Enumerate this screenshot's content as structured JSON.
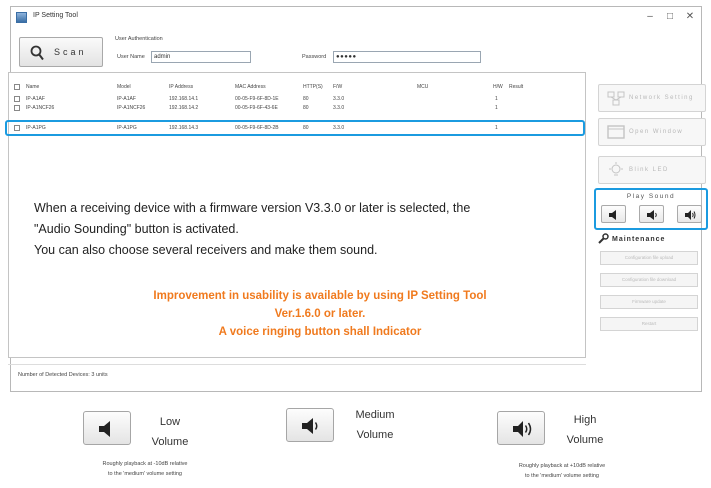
{
  "window": {
    "title": "IP Setting Tool",
    "minimize": "–",
    "maximize": "□",
    "close": "✕"
  },
  "toolbar": {
    "scan_label": "Scan"
  },
  "auth": {
    "title": "User Authentication",
    "username_label": "User Name",
    "username_value": "admin",
    "password_label": "Password",
    "password_value": "●●●●●"
  },
  "table": {
    "headers": [
      "Name",
      "Model",
      "IP Address",
      "MAC Address",
      "HTTP(S)",
      "F/W",
      "MCU",
      "H/W",
      "Result"
    ],
    "rows": [
      [
        "IP-A1AF",
        "IP-A1AF",
        "192.168.14.1",
        "00-05-F9-6F-8D-1E",
        "80",
        "3.3.0",
        "",
        "1",
        ""
      ],
      [
        "IP-A1NCF26",
        "IP-A1NCF26",
        "192.168.14.2",
        "00-05-F9-6F-43-6E",
        "80",
        "3.3.0",
        "",
        "1",
        ""
      ],
      [
        "IP-A1PG",
        "IP-A1PG",
        "192.168.14.3",
        "00-05-F9-6F-8D-2B",
        "80",
        "3.3.0",
        "",
        "1",
        ""
      ]
    ]
  },
  "info": {
    "line1": "When a receiving device with a firmware version V3.3.0 or later is selected, the",
    "line2": "\"Audio Sounding\" button is activated.",
    "line3": "You can also choose several receivers and make them sound."
  },
  "notice": {
    "line1": "Improvement in usability is available by using IP Setting Tool",
    "line2": "Ver.1.6.0 or later.",
    "line3": "A voice ringing button shall Indicator"
  },
  "status": {
    "text": "Number of Detected Devices: 3 units"
  },
  "side": {
    "network_setting": "Network Setting",
    "open_window": "Open Window",
    "blink_led": "Blink LED",
    "play_sound": "Play Sound",
    "maintenance": "Maintenance",
    "maintenance_items": [
      "Configuration file upload",
      "Configuration file download",
      "Firmware update",
      "Restart"
    ]
  },
  "legend": {
    "low": {
      "label1": "Low",
      "label2": "Volume",
      "note1": "Roughly playback at -10dB relative",
      "note2": "to the 'medium' volume setting"
    },
    "medium": {
      "label1": "Medium",
      "label2": "Volume"
    },
    "high": {
      "label1": "High",
      "label2": "Volume",
      "note1": "Roughly playback at +10dB relative",
      "note2": "to the 'medium' volume setting"
    }
  },
  "colors": {
    "highlight": "#1b9be0",
    "notice": "#f07a1e"
  }
}
